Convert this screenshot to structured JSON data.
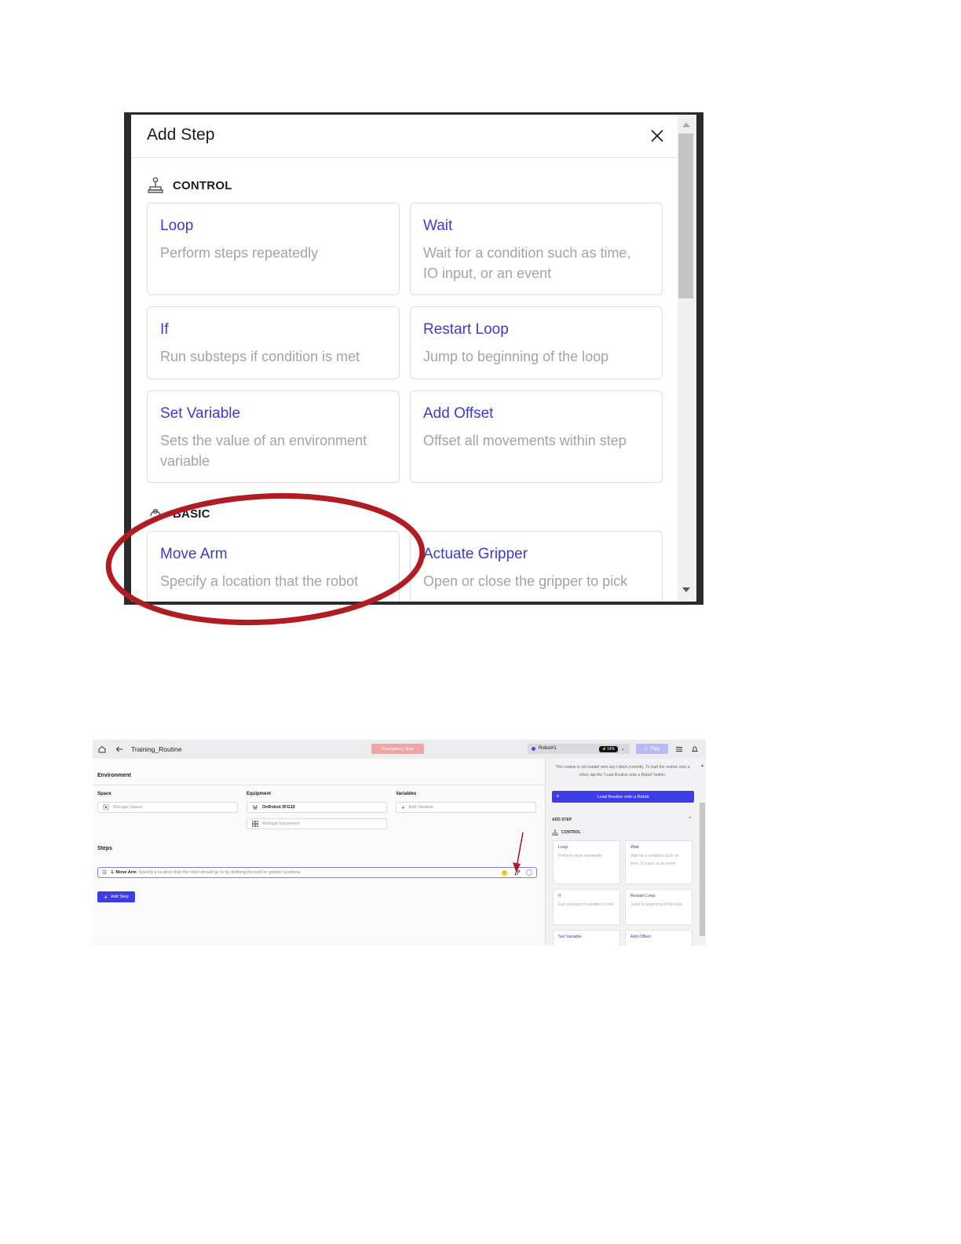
{
  "dialog": {
    "title": "Add Step",
    "sections": [
      {
        "label": "CONTROL",
        "icon": "joystick-icon",
        "cards": [
          {
            "title": "Loop",
            "desc": "Perform steps repeatedly"
          },
          {
            "title": "Wait",
            "desc": "Wait for a condition such as time, IO input, or an event"
          },
          {
            "title": "If",
            "desc": "Run substeps if condition is met"
          },
          {
            "title": "Restart Loop",
            "desc": "Jump to beginning of the loop"
          },
          {
            "title": "Set Variable",
            "desc": "Sets the value of an environment variable"
          },
          {
            "title": "Add Offset",
            "desc": "Offset all movements within step"
          }
        ]
      },
      {
        "label": "BASIC",
        "icon": "basic-icon",
        "cards": [
          {
            "title": "Move Arm",
            "desc": "Specify a location that the robot"
          },
          {
            "title": "Actuate Gripper",
            "desc": "Open or close the gripper to pick"
          }
        ]
      }
    ]
  },
  "annotation": {
    "color": "#b01c22"
  },
  "editor": {
    "title": "Training_Routine",
    "emergency_stop": "Emergency Stop",
    "robot": {
      "name": "Robot#1",
      "battery": "⚡14%"
    },
    "play": "Play",
    "environment_label": "Environment",
    "space_label": "Space",
    "space_manage": "Manage Space",
    "equipment_label": "Equipment",
    "equipment_item": "OnRobot 3FG15",
    "equipment_manage": "Manage Equipment",
    "variables_label": "Variables",
    "add_variable": "Add Variable",
    "steps_label": "Steps",
    "step1": {
      "name": "1. Move Arm",
      "desc": "Specify a location that the robot should go to by defining the joint or gripper positions"
    },
    "add_step": "Add Step",
    "side": {
      "note": "This routine is not loaded onto any robots currently. To load the routine onto a robot, tap the \"Load Routine onto a Robot\" button.",
      "load_button": "Load Routine onto a Robot",
      "add_step_header": "ADD STEP",
      "control_label": "CONTROL",
      "cards": [
        {
          "title": "Loop",
          "desc": "Perform steps repeatedly"
        },
        {
          "title": "Wait",
          "desc": "Wait for a condition such as time, IO input, or an event"
        },
        {
          "title": "If",
          "desc": "Run substeps if condition is met"
        },
        {
          "title": "Restart Loop",
          "desc": "Jump to beginning of the loop"
        },
        {
          "title": "Set Variable",
          "desc": ""
        },
        {
          "title": "Add Offset",
          "desc": ""
        }
      ]
    }
  },
  "colors": {
    "accent": "#3b3bd4",
    "primary_button": "#3d3de8",
    "estop": "#f2a3a3"
  }
}
